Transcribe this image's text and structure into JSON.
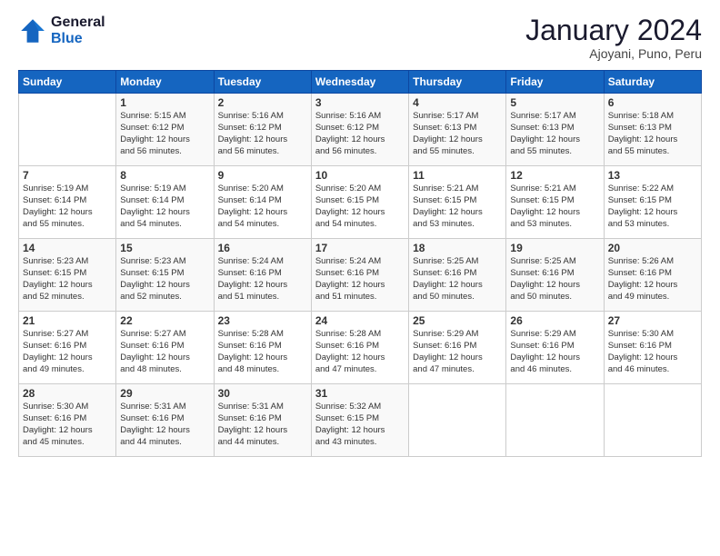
{
  "header": {
    "logo_line1": "General",
    "logo_line2": "Blue",
    "month": "January 2024",
    "location": "Ajoyani, Puno, Peru"
  },
  "days_of_week": [
    "Sunday",
    "Monday",
    "Tuesday",
    "Wednesday",
    "Thursday",
    "Friday",
    "Saturday"
  ],
  "weeks": [
    [
      {
        "day": "",
        "text": ""
      },
      {
        "day": "1",
        "text": "Sunrise: 5:15 AM\nSunset: 6:12 PM\nDaylight: 12 hours\nand 56 minutes."
      },
      {
        "day": "2",
        "text": "Sunrise: 5:16 AM\nSunset: 6:12 PM\nDaylight: 12 hours\nand 56 minutes."
      },
      {
        "day": "3",
        "text": "Sunrise: 5:16 AM\nSunset: 6:12 PM\nDaylight: 12 hours\nand 56 minutes."
      },
      {
        "day": "4",
        "text": "Sunrise: 5:17 AM\nSunset: 6:13 PM\nDaylight: 12 hours\nand 55 minutes."
      },
      {
        "day": "5",
        "text": "Sunrise: 5:17 AM\nSunset: 6:13 PM\nDaylight: 12 hours\nand 55 minutes."
      },
      {
        "day": "6",
        "text": "Sunrise: 5:18 AM\nSunset: 6:13 PM\nDaylight: 12 hours\nand 55 minutes."
      }
    ],
    [
      {
        "day": "7",
        "text": "Sunrise: 5:19 AM\nSunset: 6:14 PM\nDaylight: 12 hours\nand 55 minutes."
      },
      {
        "day": "8",
        "text": "Sunrise: 5:19 AM\nSunset: 6:14 PM\nDaylight: 12 hours\nand 54 minutes."
      },
      {
        "day": "9",
        "text": "Sunrise: 5:20 AM\nSunset: 6:14 PM\nDaylight: 12 hours\nand 54 minutes."
      },
      {
        "day": "10",
        "text": "Sunrise: 5:20 AM\nSunset: 6:15 PM\nDaylight: 12 hours\nand 54 minutes."
      },
      {
        "day": "11",
        "text": "Sunrise: 5:21 AM\nSunset: 6:15 PM\nDaylight: 12 hours\nand 53 minutes."
      },
      {
        "day": "12",
        "text": "Sunrise: 5:21 AM\nSunset: 6:15 PM\nDaylight: 12 hours\nand 53 minutes."
      },
      {
        "day": "13",
        "text": "Sunrise: 5:22 AM\nSunset: 6:15 PM\nDaylight: 12 hours\nand 53 minutes."
      }
    ],
    [
      {
        "day": "14",
        "text": "Sunrise: 5:23 AM\nSunset: 6:15 PM\nDaylight: 12 hours\nand 52 minutes."
      },
      {
        "day": "15",
        "text": "Sunrise: 5:23 AM\nSunset: 6:15 PM\nDaylight: 12 hours\nand 52 minutes."
      },
      {
        "day": "16",
        "text": "Sunrise: 5:24 AM\nSunset: 6:16 PM\nDaylight: 12 hours\nand 51 minutes."
      },
      {
        "day": "17",
        "text": "Sunrise: 5:24 AM\nSunset: 6:16 PM\nDaylight: 12 hours\nand 51 minutes."
      },
      {
        "day": "18",
        "text": "Sunrise: 5:25 AM\nSunset: 6:16 PM\nDaylight: 12 hours\nand 50 minutes."
      },
      {
        "day": "19",
        "text": "Sunrise: 5:25 AM\nSunset: 6:16 PM\nDaylight: 12 hours\nand 50 minutes."
      },
      {
        "day": "20",
        "text": "Sunrise: 5:26 AM\nSunset: 6:16 PM\nDaylight: 12 hours\nand 49 minutes."
      }
    ],
    [
      {
        "day": "21",
        "text": "Sunrise: 5:27 AM\nSunset: 6:16 PM\nDaylight: 12 hours\nand 49 minutes."
      },
      {
        "day": "22",
        "text": "Sunrise: 5:27 AM\nSunset: 6:16 PM\nDaylight: 12 hours\nand 48 minutes."
      },
      {
        "day": "23",
        "text": "Sunrise: 5:28 AM\nSunset: 6:16 PM\nDaylight: 12 hours\nand 48 minutes."
      },
      {
        "day": "24",
        "text": "Sunrise: 5:28 AM\nSunset: 6:16 PM\nDaylight: 12 hours\nand 47 minutes."
      },
      {
        "day": "25",
        "text": "Sunrise: 5:29 AM\nSunset: 6:16 PM\nDaylight: 12 hours\nand 47 minutes."
      },
      {
        "day": "26",
        "text": "Sunrise: 5:29 AM\nSunset: 6:16 PM\nDaylight: 12 hours\nand 46 minutes."
      },
      {
        "day": "27",
        "text": "Sunrise: 5:30 AM\nSunset: 6:16 PM\nDaylight: 12 hours\nand 46 minutes."
      }
    ],
    [
      {
        "day": "28",
        "text": "Sunrise: 5:30 AM\nSunset: 6:16 PM\nDaylight: 12 hours\nand 45 minutes."
      },
      {
        "day": "29",
        "text": "Sunrise: 5:31 AM\nSunset: 6:16 PM\nDaylight: 12 hours\nand 44 minutes."
      },
      {
        "day": "30",
        "text": "Sunrise: 5:31 AM\nSunset: 6:16 PM\nDaylight: 12 hours\nand 44 minutes."
      },
      {
        "day": "31",
        "text": "Sunrise: 5:32 AM\nSunset: 6:15 PM\nDaylight: 12 hours\nand 43 minutes."
      },
      {
        "day": "",
        "text": ""
      },
      {
        "day": "",
        "text": ""
      },
      {
        "day": "",
        "text": ""
      }
    ]
  ]
}
